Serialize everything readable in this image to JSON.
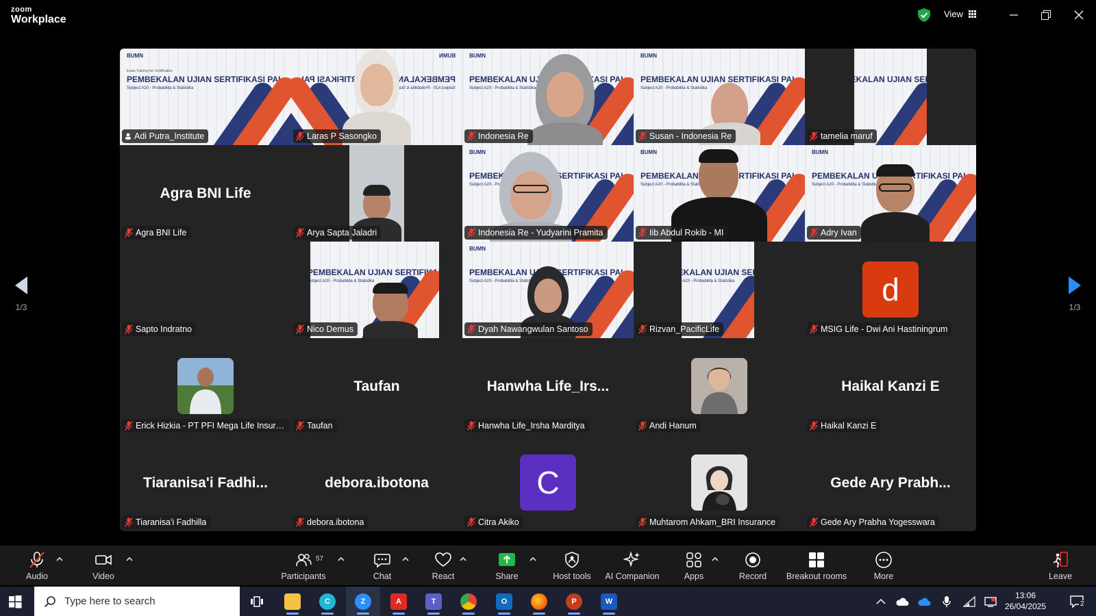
{
  "app": {
    "logo_top": "zoom",
    "logo_bottom": "Workplace",
    "view_label": "View"
  },
  "gallery": {
    "slide": {
      "brand": "BUMN",
      "small": "Exam Training for Certification",
      "headline": "PEMBEKALAN UJIAN SERTIFIKASI PAI",
      "subheadline": "Subject A20 - Probabilita & Statistika"
    },
    "tiles": [
      {
        "name": "Adi Putra_Institute"
      },
      {
        "name": "Laras P Sasongko"
      },
      {
        "name": "Indonesia Re"
      },
      {
        "name": "Susan - Indonesia Re"
      },
      {
        "name": "tamelia maruf"
      },
      {
        "name": "Agra BNI Life",
        "display": "Agra BNI Life"
      },
      {
        "name": "Arya Sapta Jaladri"
      },
      {
        "name": "Indonesia Re - Yudyarini Pramita"
      },
      {
        "name": "Iib Abdul Rokib - MI"
      },
      {
        "name": "Adry Ivan"
      },
      {
        "name": "Sapto Indratno"
      },
      {
        "name": "Nico Demus"
      },
      {
        "name": "Dyah Nawangwulan Santoso"
      },
      {
        "name": "Rizvan_PacificLife"
      },
      {
        "name": "MSIG Life - Dwi Ani Hastiningrum",
        "initial": "d",
        "color": "#d93a10"
      },
      {
        "name": "Erick Hizkia - PT PFI Mega Life Insura..."
      },
      {
        "name": "Taufan",
        "display": "Taufan"
      },
      {
        "name": "Hanwha Life_Irsha Marditya",
        "display": "Hanwha Life_Irs..."
      },
      {
        "name": "Andi Hanum"
      },
      {
        "name": "Haikal Kanzi E",
        "display": "Haikal Kanzi E"
      },
      {
        "name": "Tiaranisa'i Fadhilla",
        "display": "Tiaranisa'i  Fadhi..."
      },
      {
        "name": "debora.ibotona",
        "display": "debora.ibotona"
      },
      {
        "name": "Citra Akiko",
        "initial": "C",
        "color": "#5a2fc2"
      },
      {
        "name": "Muhtarom Ahkam_BRI Insurance"
      },
      {
        "name": "Gede Ary Prabha Yogesswara",
        "display": "Gede  Ary  Prabh..."
      }
    ]
  },
  "pagination": {
    "left": "1/3",
    "right": "1/3"
  },
  "toolbar": {
    "audio": "Audio",
    "video": "Video",
    "participants": "Participants",
    "participants_count": "57",
    "chat": "Chat",
    "react": "React",
    "share": "Share",
    "host_tools": "Host tools",
    "ai_companion": "AI Companion",
    "apps": "Apps",
    "record": "Record",
    "breakout": "Breakout rooms",
    "more": "More",
    "leave": "Leave"
  },
  "colors": {
    "share": "#1fb84a",
    "active_speaker": "#2ed573",
    "leave": "#e02828"
  },
  "taskbar": {
    "search_placeholder": "Type here to search",
    "time": "13:06",
    "date": "26/04/2025",
    "notifications": "2",
    "apps": [
      "File Explorer",
      "Canva",
      "Zoom",
      "Adobe Acrobat",
      "Microsoft Teams",
      "Google Chrome",
      "Outlook",
      "Firefox",
      "PowerPoint",
      "Word"
    ]
  }
}
